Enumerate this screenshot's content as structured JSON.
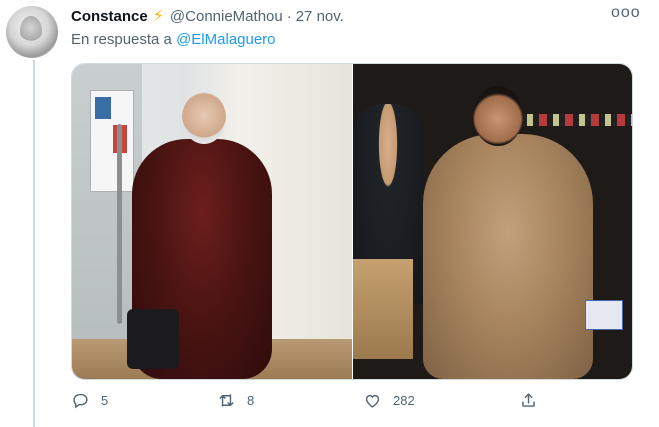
{
  "tweet": {
    "author_name": "Constance",
    "author_badge_icon": "lightning-bolt-icon",
    "handle": "@ConnieMathou",
    "separator": "·",
    "timestamp": "27 nov.",
    "reply_prefix": "En respuesta a",
    "reply_to": "@ElMalaguero",
    "more_icon": "ooo",
    "media": [
      {
        "description_icon": "photo-woman-red-fur-coat"
      },
      {
        "description_icon": "photo-man-fur-coat"
      }
    ]
  },
  "actions": {
    "reply_count": "5",
    "retweet_count": "8",
    "like_count": "282",
    "share_count": ""
  },
  "colors": {
    "accent": "#1d9bf0",
    "muted": "#536471",
    "thread_line": "#cfd9de"
  }
}
